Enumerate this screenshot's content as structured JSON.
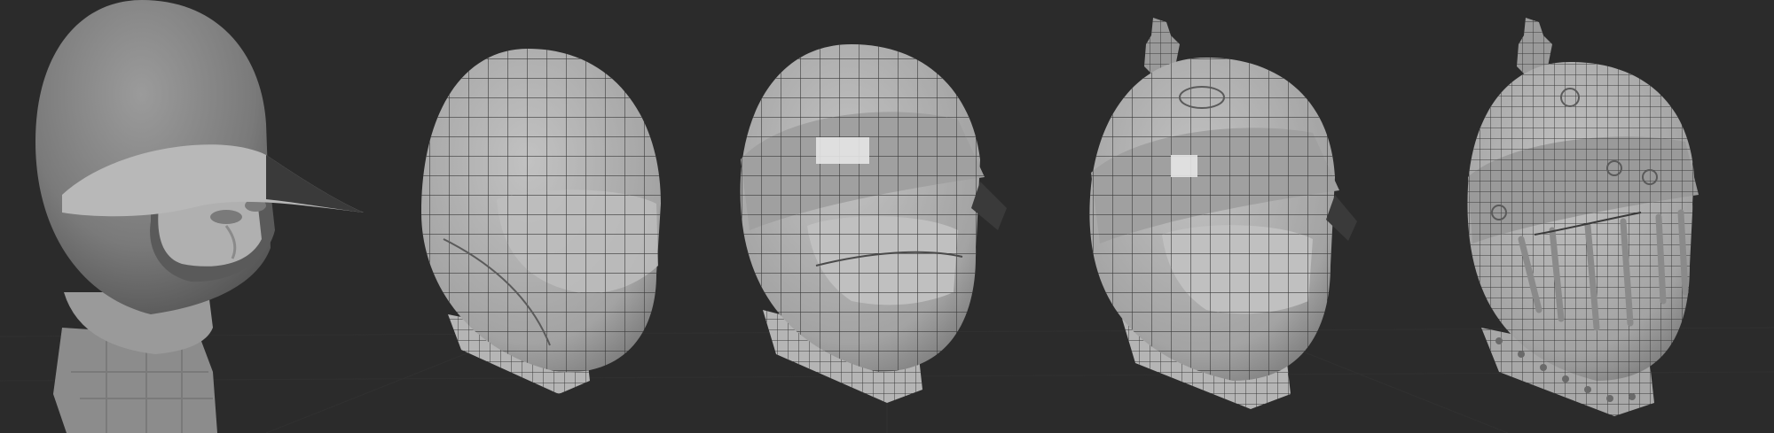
{
  "scene": {
    "background_color": "#2b2b2b",
    "grid_color": "#333333",
    "mesh_fill": "#a9a9a9",
    "mesh_shadow": "#6f6f6f",
    "wire_color": "#3a3a3a",
    "sculpt_fill": "#8a8a8a",
    "highlight_color": "#e6e6e6",
    "stages": [
      {
        "id": "sculpt",
        "icon": "sculpted-head-with-cap-icon"
      },
      {
        "id": "base-mesh",
        "icon": "helmet-base-mesh-icon"
      },
      {
        "id": "brim-added",
        "icon": "helmet-with-brim-icon"
      },
      {
        "id": "crest-added",
        "icon": "helmet-with-crest-icon"
      },
      {
        "id": "final-detail",
        "icon": "helmet-final-detail-icon"
      }
    ]
  }
}
